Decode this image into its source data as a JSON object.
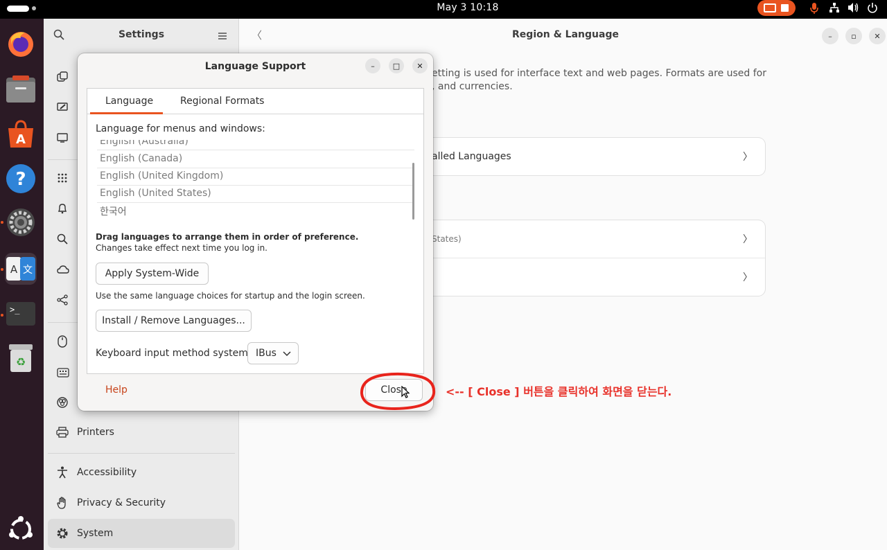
{
  "topbar": {
    "clock": "May 3  10:18"
  },
  "dock": {
    "items": [
      "firefox-icon",
      "files-icon",
      "app-center-icon",
      "help-icon",
      "settings-icon",
      "language-icon",
      "terminal-icon",
      "trash-icon",
      "ubuntu-logo-icon"
    ]
  },
  "settings": {
    "sidebar_title": "Settings",
    "sidebar_items": [
      "Printers",
      "Accessibility",
      "Privacy & Security",
      "System"
    ],
    "selected": "System",
    "main_title": "Region & Language",
    "description_visible": [
      "etting is used for interface text and web pages. Formats are used for",
      ", and currencies."
    ],
    "manage_installed_languages": "alled Languages",
    "formats_value_partial": "States)"
  },
  "dialog": {
    "title": "Language Support",
    "tabs": [
      "Language",
      "Regional Formats"
    ],
    "active_tab": "Language",
    "menus_label": "Language for menus and windows:",
    "languages": [
      "English (Australia)",
      "English (Canada)",
      "English (United Kingdom)",
      "English (United States)",
      "한국어"
    ],
    "drag_hint_bold": "Drag languages to arrange them in order of preference.",
    "drag_hint": "Changes take effect next time you log in.",
    "apply_button": "Apply System-Wide",
    "apply_hint": "Use the same language choices for startup and the login screen.",
    "install_button": "Install / Remove Languages...",
    "keyboard_label": "Keyboard input method system:",
    "keyboard_value": "IBus",
    "help_button": "Help",
    "close_button": "Close"
  },
  "annotation": {
    "text": "<-- [ Close ] 버튼을 클릭하여 화면을 닫는다.",
    "color": "#e8312a"
  },
  "colors": {
    "accent": "#e95420",
    "dock_bg": "#2b1a25"
  }
}
